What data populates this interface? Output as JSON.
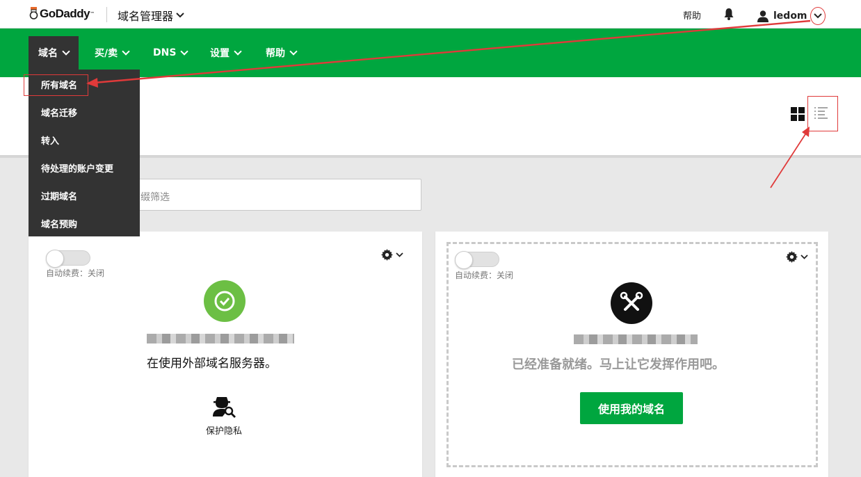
{
  "header": {
    "logo_text": "GoDaddy",
    "logo_tm": "™",
    "app_title": "域名管理器",
    "help_label": "帮助",
    "username": "ledom"
  },
  "nav": {
    "items": [
      {
        "label": "域名"
      },
      {
        "label": "买/卖"
      },
      {
        "label": "DNS"
      },
      {
        "label": "设置"
      },
      {
        "label": "帮助"
      }
    ]
  },
  "dropdown": {
    "items": [
      {
        "label": "所有域名"
      },
      {
        "label": "域名迁移"
      },
      {
        "label": "转入"
      },
      {
        "label": "待处理的账户变更"
      },
      {
        "label": "过期域名"
      },
      {
        "label": "域名预购"
      }
    ]
  },
  "filter": {
    "visible_text": "缀筛选"
  },
  "cards": [
    {
      "autorenew": "自动续费：关闭",
      "status_text": "在使用外部域名服务器。",
      "privacy_label": "保护隐私"
    },
    {
      "autorenew": "自动续费：关闭",
      "status_text": "已经准备就绪。马上让它发挥作用吧。",
      "button_label": "使用我的域名"
    }
  ],
  "colors": {
    "brand_green": "#00a63f",
    "nav_active": "#333333",
    "annotation_red": "#e03a3a"
  },
  "icons": [
    "bell-icon",
    "user-icon",
    "chevron-down-icon",
    "grid-view-icon",
    "list-view-icon",
    "gear-icon",
    "check-circle-icon",
    "tools-icon",
    "privacy-icon"
  ]
}
